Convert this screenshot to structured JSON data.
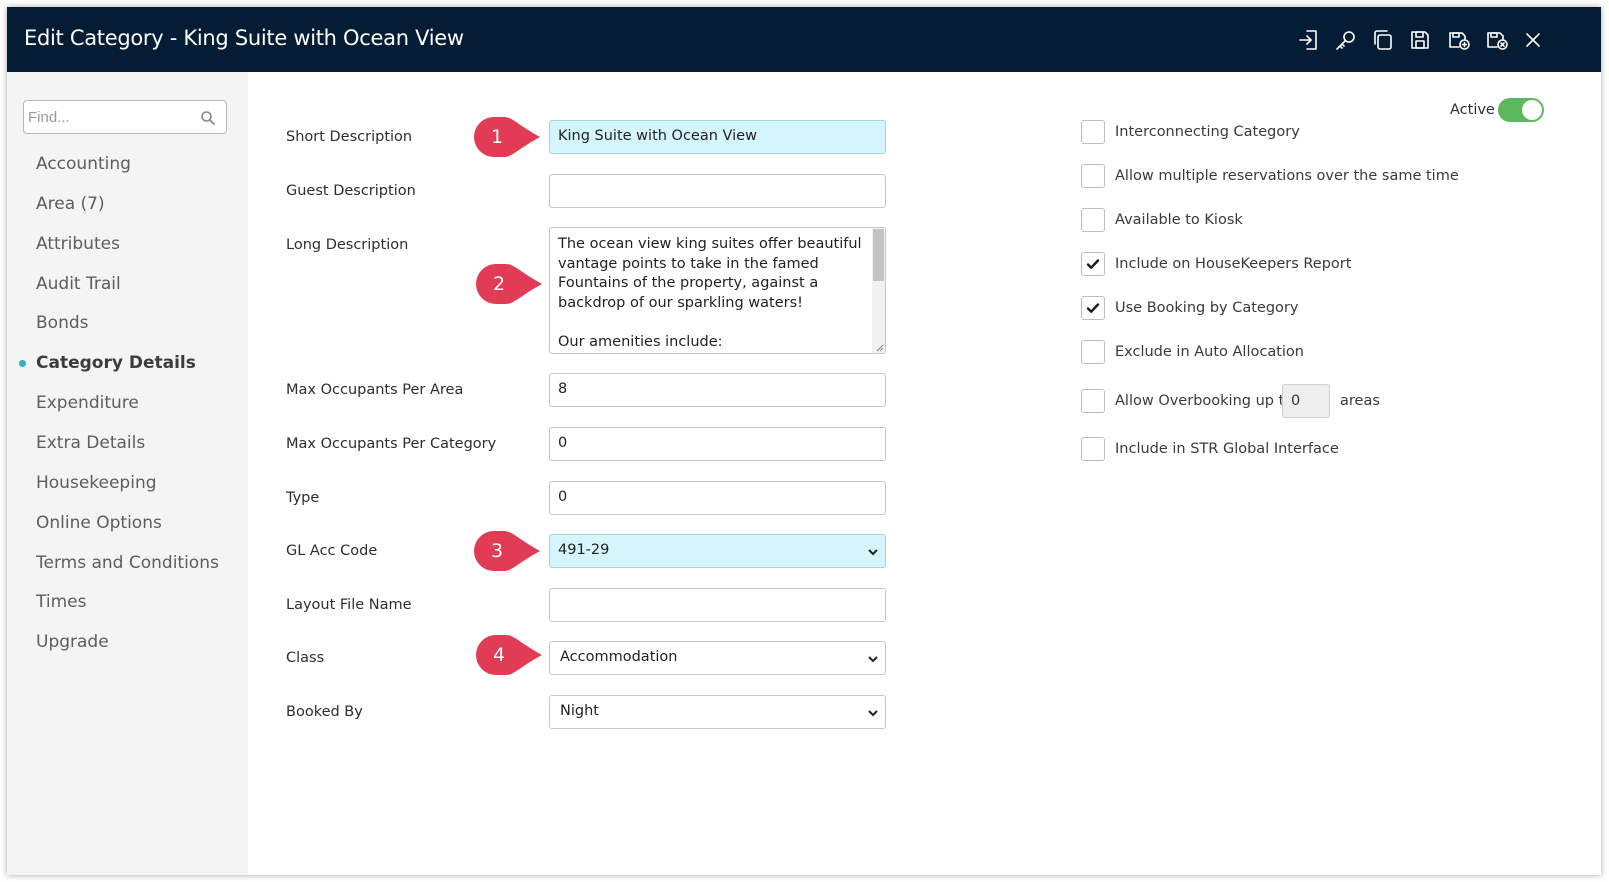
{
  "window": {
    "title": "Edit Category - King Suite with Ocean View"
  },
  "toolbar": [
    {
      "name": "import-icon"
    },
    {
      "name": "key-icon"
    },
    {
      "name": "copy-icon"
    },
    {
      "name": "save-icon"
    },
    {
      "name": "save-new-icon"
    },
    {
      "name": "save-close-icon"
    },
    {
      "name": "close-icon"
    }
  ],
  "sidebar": {
    "search_placeholder": "Find...",
    "items": [
      {
        "label": "Accounting"
      },
      {
        "label": "Area (7)"
      },
      {
        "label": "Attributes"
      },
      {
        "label": "Audit Trail"
      },
      {
        "label": "Bonds"
      },
      {
        "label": "Category Details",
        "active": true
      },
      {
        "label": "Expenditure"
      },
      {
        "label": "Extra Details"
      },
      {
        "label": "Housekeeping"
      },
      {
        "label": "Online Options"
      },
      {
        "label": "Terms and Conditions"
      },
      {
        "label": "Times"
      },
      {
        "label": "Upgrade"
      }
    ]
  },
  "form": {
    "short_description": {
      "label": "Short Description",
      "value": "King Suite with Ocean View"
    },
    "guest_description": {
      "label": "Guest Description",
      "value": ""
    },
    "long_description": {
      "label": "Long Description",
      "value": "The ocean view king suites offer beautiful vantage points to take in the famed Fountains of the property, against a backdrop of our sparkling waters!\n\nOur amenities include:"
    },
    "max_occupants_area": {
      "label": "Max Occupants Per Area",
      "value": "8"
    },
    "max_occupants_category": {
      "label": "Max Occupants Per Category",
      "value": "0"
    },
    "type": {
      "label": "Type",
      "value": "0"
    },
    "gl_acc_code": {
      "label": "GL Acc Code",
      "value": "491-29"
    },
    "layout_file_name": {
      "label": "Layout File Name",
      "value": ""
    },
    "class": {
      "label": "Class",
      "value": "Accommodation"
    },
    "booked_by": {
      "label": "Booked By",
      "value": "Night"
    }
  },
  "badges": [
    "1",
    "2",
    "3",
    "4"
  ],
  "badge_color": "#e23b55",
  "active": {
    "label": "Active",
    "on": true
  },
  "checkboxes": [
    {
      "label": "Interconnecting Category",
      "checked": false
    },
    {
      "label": "Allow multiple reservations over the same time",
      "checked": false
    },
    {
      "label": "Available to Kiosk",
      "checked": false
    },
    {
      "label": "Include on HouseKeepers Report",
      "checked": true
    },
    {
      "label": "Use Booking by Category",
      "checked": true
    },
    {
      "label": "Exclude in Auto Allocation",
      "checked": false
    },
    {
      "label": "Allow Overbooking up to",
      "checked": false
    },
    {
      "label": "Include in STR Global Interface",
      "checked": false
    }
  ],
  "overbooking": {
    "value": "0",
    "suffix": "areas"
  }
}
